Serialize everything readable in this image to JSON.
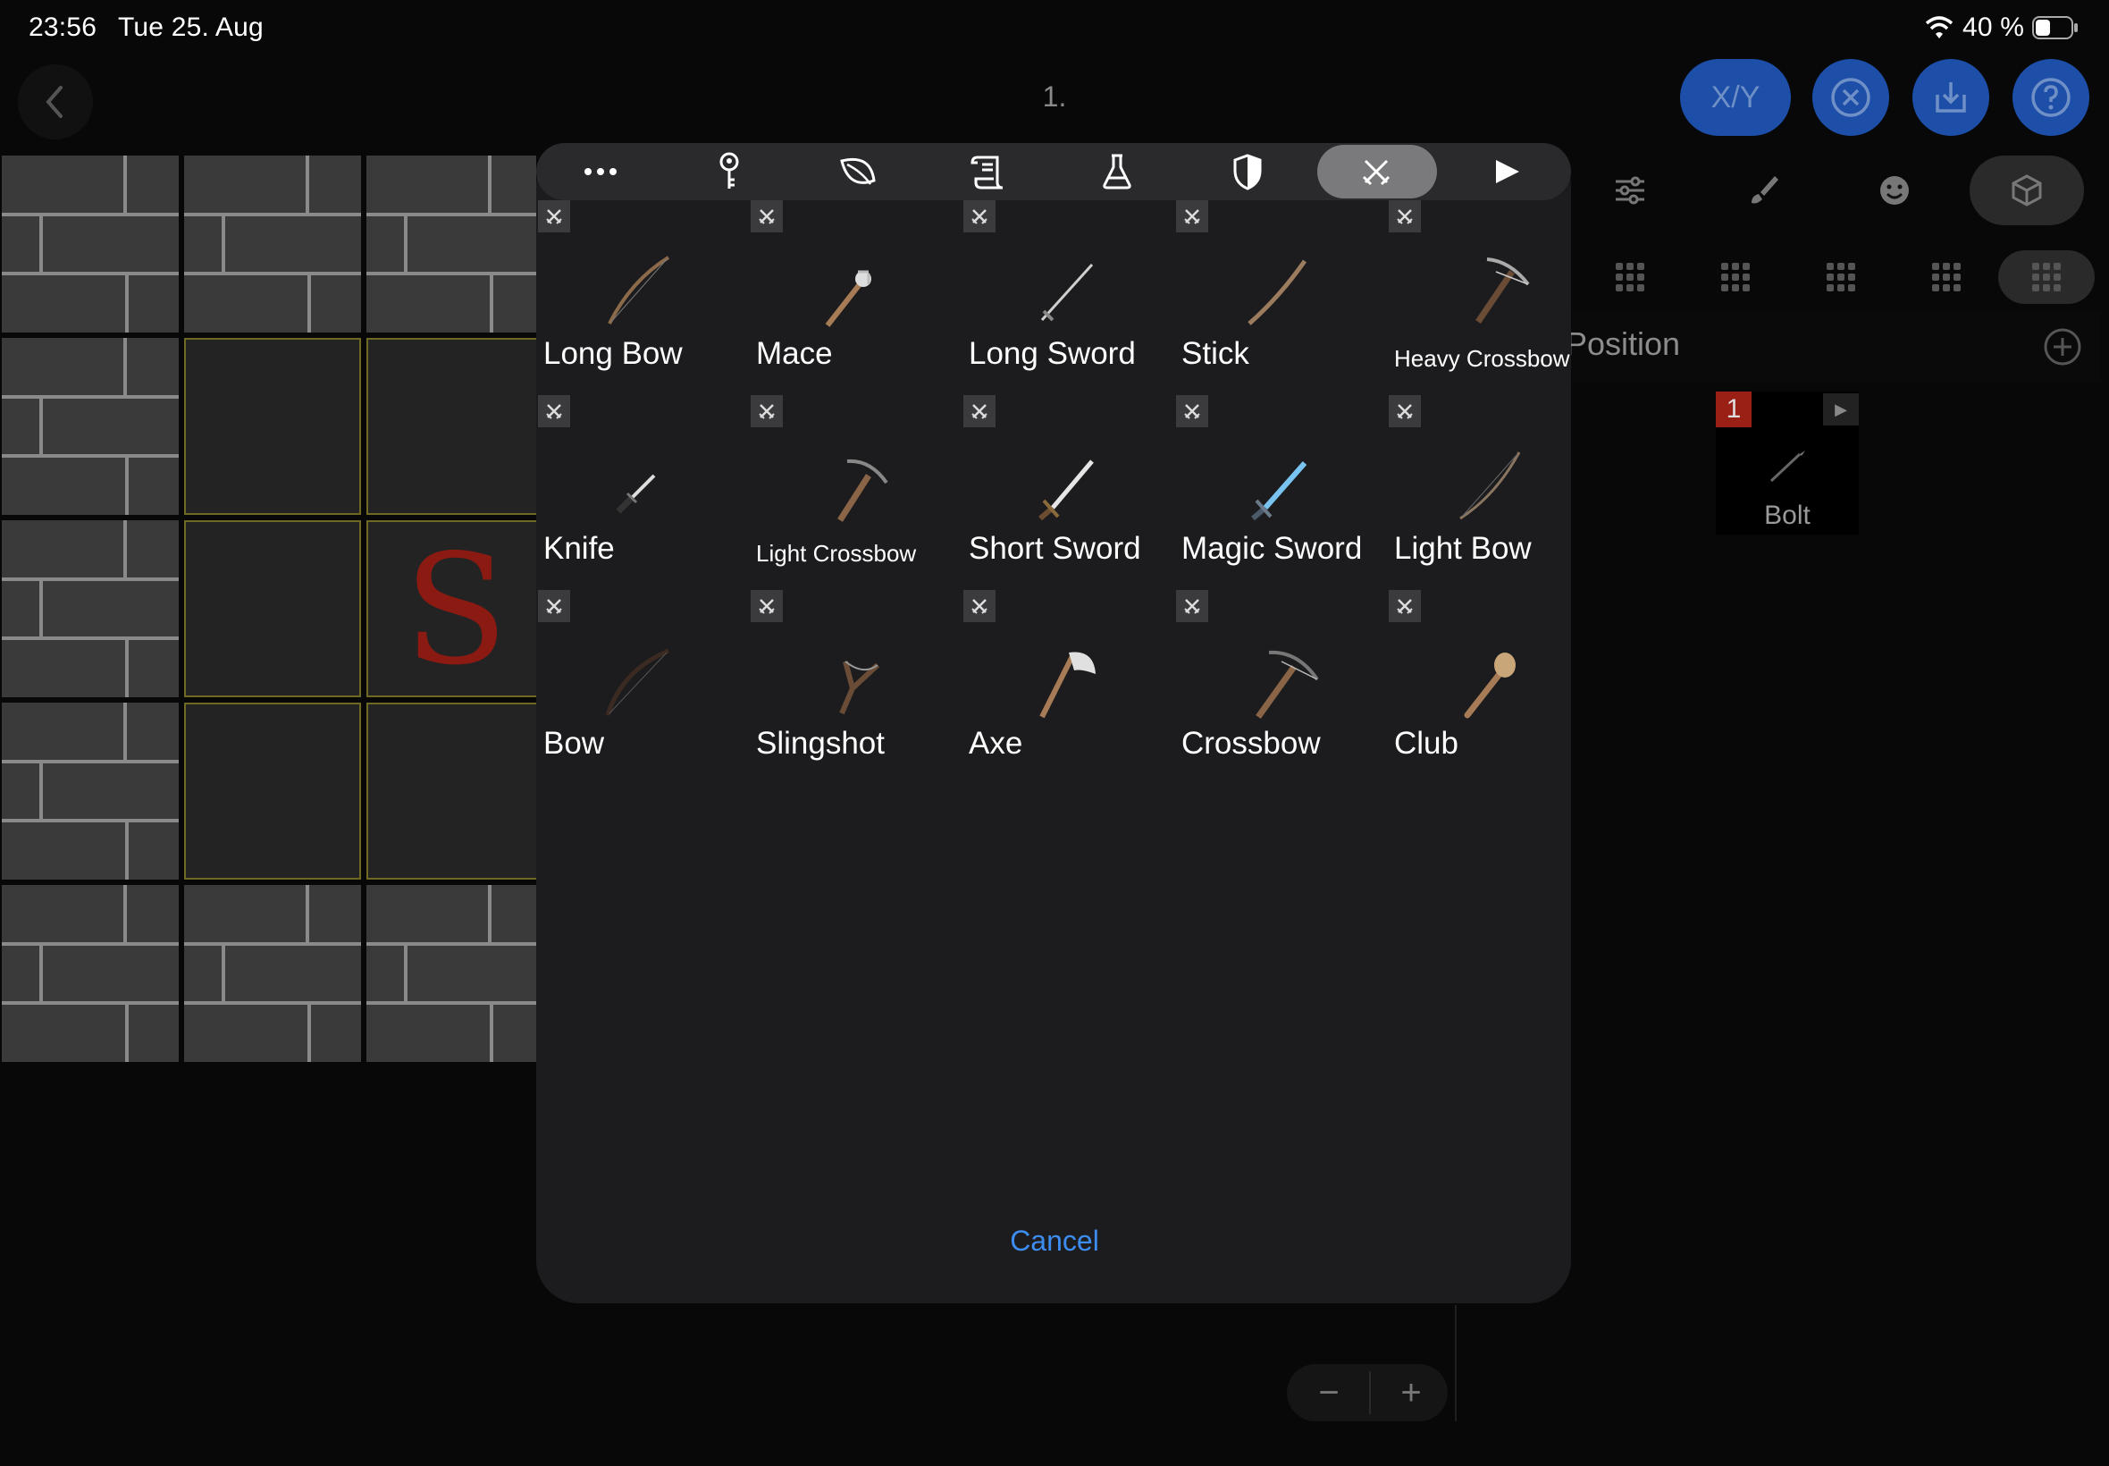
{
  "status_bar": {
    "time": "23:56",
    "date": "Tue 25. Aug",
    "battery": "40 %"
  },
  "header": {
    "page_title": "1.",
    "buttons": [
      {
        "label": "X/Y",
        "icon": "xy-button"
      },
      {
        "label": "",
        "icon": "close-circle-icon"
      },
      {
        "label": "",
        "icon": "download-icon"
      },
      {
        "label": "",
        "icon": "help-icon"
      }
    ]
  },
  "map": {
    "floor_letter": "S"
  },
  "right_panel": {
    "tabs": [
      "settings-sliders-icon",
      "brush-icon",
      "smiley-icon",
      "cube-icon"
    ],
    "selected_tab": 3,
    "sub_tab_count": 5,
    "selected_sub_tab": 4,
    "section_label": "Position",
    "card": {
      "badge": "1",
      "label": "Bolt"
    }
  },
  "modal": {
    "toolbar_icons": [
      "more-icon",
      "key-icon",
      "leaf-icon",
      "scroll-icon",
      "flask-icon",
      "shield-icon",
      "swords-icon",
      "play-icon"
    ],
    "selected_toolbar_index": 6,
    "items": [
      {
        "label": "Long Bow",
        "small": false
      },
      {
        "label": "Mace",
        "small": false
      },
      {
        "label": "Long Sword",
        "small": false
      },
      {
        "label": "Stick",
        "small": false
      },
      {
        "label": "Heavy Crossbow",
        "small": true
      },
      {
        "label": "Knife",
        "small": false
      },
      {
        "label": "Light Crossbow",
        "small": true
      },
      {
        "label": "Short Sword",
        "small": false
      },
      {
        "label": "Magic Sword",
        "small": false
      },
      {
        "label": "Light Bow",
        "small": false
      },
      {
        "label": "Bow",
        "small": false
      },
      {
        "label": "Slingshot",
        "small": false
      },
      {
        "label": "Axe",
        "small": false
      },
      {
        "label": "Crossbow",
        "small": false
      },
      {
        "label": "Club",
        "small": false
      }
    ],
    "cancel_label": "Cancel"
  },
  "zoom": {
    "minus": "−",
    "plus": "+"
  }
}
